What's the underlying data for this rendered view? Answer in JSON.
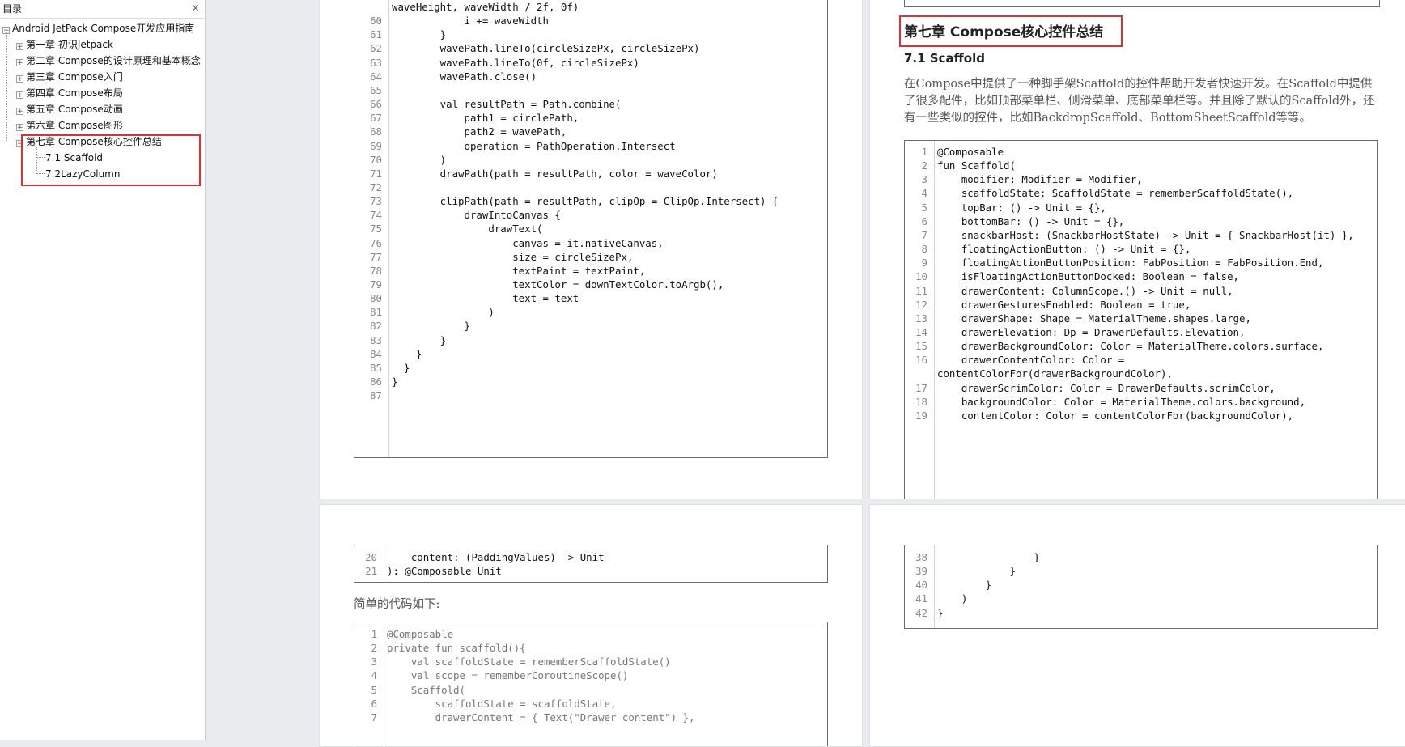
{
  "toc": {
    "title": "目录",
    "close": "×",
    "root": "Android JetPack Compose开发应用指南",
    "chapters": [
      {
        "label": "第一章 初识Jetpack",
        "toggle": "+"
      },
      {
        "label": "第二章 Compose的设计原理和基本概念",
        "toggle": "+"
      },
      {
        "label": "第三章 Compose入门",
        "toggle": "+"
      },
      {
        "label": "第四章 Compose布局",
        "toggle": "+"
      },
      {
        "label": "第五章 Compose动画",
        "toggle": "+"
      },
      {
        "label": "第六章 Compose图形",
        "toggle": "+"
      },
      {
        "label": "第七章 Compose核心控件总结",
        "toggle": "−"
      }
    ],
    "sub_items": [
      "7.1 Scaffold",
      "7.2LazyColumn"
    ]
  },
  "page1": {
    "code": [
      {
        "n": "",
        "t": "waveHeight, waveWidth / 2f, 0f)"
      },
      {
        "n": "60",
        "t": "            i += waveWidth"
      },
      {
        "n": "61",
        "t": "        }"
      },
      {
        "n": "62",
        "t": "        wavePath.lineTo(circleSizePx, circleSizePx)"
      },
      {
        "n": "63",
        "t": "        wavePath.lineTo(0f, circleSizePx)"
      },
      {
        "n": "64",
        "t": "        wavePath.close()"
      },
      {
        "n": "65",
        "t": ""
      },
      {
        "n": "66",
        "t": "        val resultPath = Path.combine("
      },
      {
        "n": "67",
        "t": "            path1 = circlePath,"
      },
      {
        "n": "68",
        "t": "            path2 = wavePath,"
      },
      {
        "n": "69",
        "t": "            operation = PathOperation.Intersect"
      },
      {
        "n": "70",
        "t": "        )"
      },
      {
        "n": "71",
        "t": "        drawPath(path = resultPath, color = waveColor)"
      },
      {
        "n": "72",
        "t": ""
      },
      {
        "n": "73",
        "t": "        clipPath(path = resultPath, clipOp = ClipOp.Intersect) {"
      },
      {
        "n": "74",
        "t": "            drawIntoCanvas {"
      },
      {
        "n": "75",
        "t": "                drawText("
      },
      {
        "n": "76",
        "t": "                    canvas = it.nativeCanvas,"
      },
      {
        "n": "77",
        "t": "                    size = circleSizePx,"
      },
      {
        "n": "78",
        "t": "                    textPaint = textPaint,"
      },
      {
        "n": "79",
        "t": "                    textColor = downTextColor.toArgb(),"
      },
      {
        "n": "80",
        "t": "                    text = text"
      },
      {
        "n": "81",
        "t": "                )"
      },
      {
        "n": "82",
        "t": "            }"
      },
      {
        "n": "83",
        "t": "        }"
      },
      {
        "n": "84",
        "t": "    }"
      },
      {
        "n": "85",
        "t": "  }"
      },
      {
        "n": "86",
        "t": "}"
      },
      {
        "n": "87",
        "t": ""
      }
    ]
  },
  "page2": {
    "chapter_title": "第七章 Compose核心控件总结",
    "section_title": "7.1 Scaffold",
    "paragraph": "在Compose中提供了一种脚手架Scaffold的控件帮助开发者快速开发。在Scaffold中提供了很多配件，比如顶部菜单栏、侧滑菜单、底部菜单栏等。并且除了默认的Scaffold外，还有一些类似的控件，比如BackdropScaffold、BottomSheetScaffold等等。",
    "code": [
      {
        "n": "1",
        "t": "@Composable"
      },
      {
        "n": "2",
        "t": "fun Scaffold("
      },
      {
        "n": "3",
        "t": "    modifier: Modifier = Modifier,"
      },
      {
        "n": "4",
        "t": "    scaffoldState: ScaffoldState = rememberScaffoldState(),"
      },
      {
        "n": "5",
        "t": "    topBar: () -> Unit = {},"
      },
      {
        "n": "6",
        "t": "    bottomBar: () -> Unit = {},"
      },
      {
        "n": "7",
        "t": "    snackbarHost: (SnackbarHostState) -> Unit = { SnackbarHost(it) },"
      },
      {
        "n": "8",
        "t": "    floatingActionButton: () -> Unit = {},"
      },
      {
        "n": "9",
        "t": "    floatingActionButtonPosition: FabPosition = FabPosition.End,"
      },
      {
        "n": "10",
        "t": "    isFloatingActionButtonDocked: Boolean = false,"
      },
      {
        "n": "11",
        "t": "    drawerContent: ColumnScope.() -> Unit = null,"
      },
      {
        "n": "12",
        "t": "    drawerGesturesEnabled: Boolean = true,"
      },
      {
        "n": "13",
        "t": "    drawerShape: Shape = MaterialTheme.shapes.large,"
      },
      {
        "n": "14",
        "t": "    drawerElevation: Dp = DrawerDefaults.Elevation,"
      },
      {
        "n": "15",
        "t": "    drawerBackgroundColor: Color = MaterialTheme.colors.surface,"
      },
      {
        "n": "16",
        "t": "    drawerContentColor: Color ="
      },
      {
        "n": "",
        "t": "contentColorFor(drawerBackgroundColor),"
      },
      {
        "n": "17",
        "t": "    drawerScrimColor: Color = DrawerDefaults.scrimColor,"
      },
      {
        "n": "18",
        "t": "    backgroundColor: Color = MaterialTheme.colors.background,"
      },
      {
        "n": "19",
        "t": "    contentColor: Color = contentColorFor(backgroundColor),"
      }
    ]
  },
  "page3": {
    "code_top": [
      {
        "n": "20",
        "t": "    content: (PaddingValues) -> Unit"
      },
      {
        "n": "21",
        "t": "): @Composable Unit"
      }
    ],
    "paragraph": "简单的代码如下:",
    "code_bottom": [
      {
        "n": "1",
        "t": "@Composable"
      },
      {
        "n": "2",
        "t": "private fun scaffold(){"
      },
      {
        "n": "3",
        "t": "    val scaffoldState = rememberScaffoldState()"
      },
      {
        "n": "4",
        "t": "    val scope = rememberCoroutineScope()"
      },
      {
        "n": "5",
        "t": "    Scaffold("
      },
      {
        "n": "6",
        "t": "        scaffoldState = scaffoldState,"
      },
      {
        "n": "7",
        "t": "        drawerContent = { Text(\"Drawer content\") },"
      }
    ]
  },
  "page4": {
    "code": [
      {
        "n": "38",
        "t": "                }"
      },
      {
        "n": "39",
        "t": "            }"
      },
      {
        "n": "40",
        "t": "        }"
      },
      {
        "n": "41",
        "t": "    )"
      },
      {
        "n": "42",
        "t": "}"
      }
    ]
  },
  "colors": {
    "highlight": "#e03030",
    "keyword": "#0000cc",
    "literal": "#0a7d3a",
    "number": "#0a7d3a"
  }
}
